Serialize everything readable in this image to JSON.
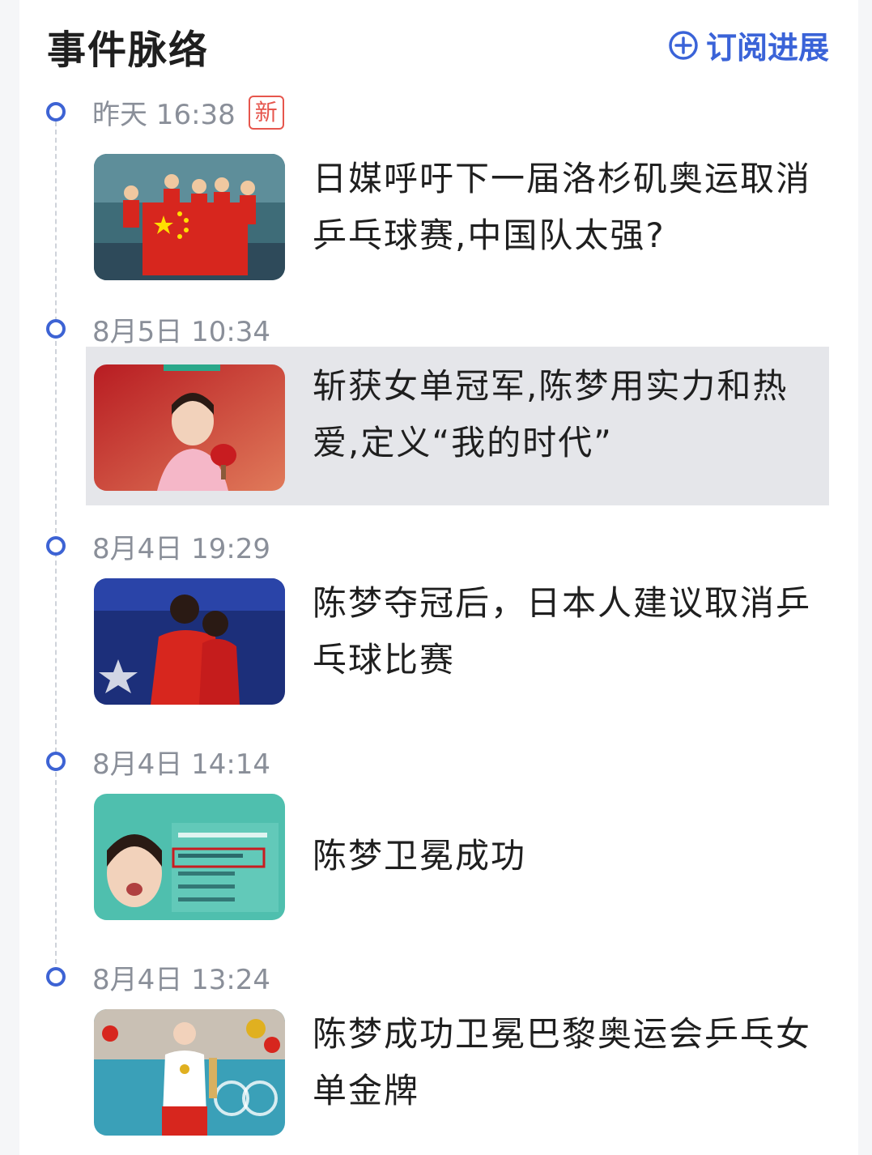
{
  "header": {
    "title": "事件脉络",
    "subscribe_label": "订阅进展"
  },
  "colors": {
    "accent": "#3a63d8",
    "new_badge": "#e6564d",
    "time_text": "#8a8f99",
    "highlight_bg": "#e5e6ea"
  },
  "timeline": [
    {
      "time": "昨天 16:38",
      "badge": "新",
      "headline": "日媒呼吁下一届洛杉矶奥运取消乒乓球赛,中国队太强?",
      "image": "team-with-chinese-flag"
    },
    {
      "time": "8月5日 10:34",
      "headline": "斩获女单冠军,陈梦用实力和热爱,定义“我的时代”",
      "image": "chen-meng-portrait-red"
    },
    {
      "time": "8月4日 19:29",
      "headline": "陈梦夺冠后，日本人建议取消乒乓球比赛",
      "image": "players-embracing"
    },
    {
      "time": "8月4日 14:14",
      "headline": "陈梦卫冕成功",
      "image": "champions-list-graphic"
    },
    {
      "time": "8月4日 13:24",
      "headline": "陈梦成功卫冕巴黎奥运会乒乓女单金牌",
      "image": "medal-ceremony"
    }
  ]
}
